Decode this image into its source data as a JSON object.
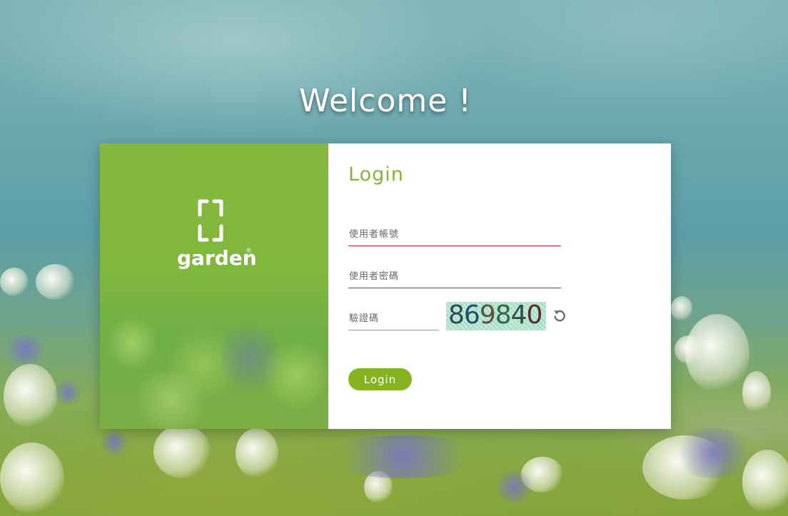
{
  "page": {
    "welcome_text": "Welcome !"
  },
  "brand": {
    "name": "garden",
    "registered_mark": "®"
  },
  "login_form": {
    "title": "Login",
    "username_placeholder": "使用者帳號",
    "password_placeholder": "使用者密碼",
    "captcha_placeholder": "驗證碼",
    "captcha_code": "869840",
    "refresh_icon": "refresh-icon",
    "submit_label": "Login"
  },
  "colors": {
    "accent_green": "#86b33a",
    "panel_green": "#80b73d",
    "field_underline_red": "#c0262d"
  }
}
